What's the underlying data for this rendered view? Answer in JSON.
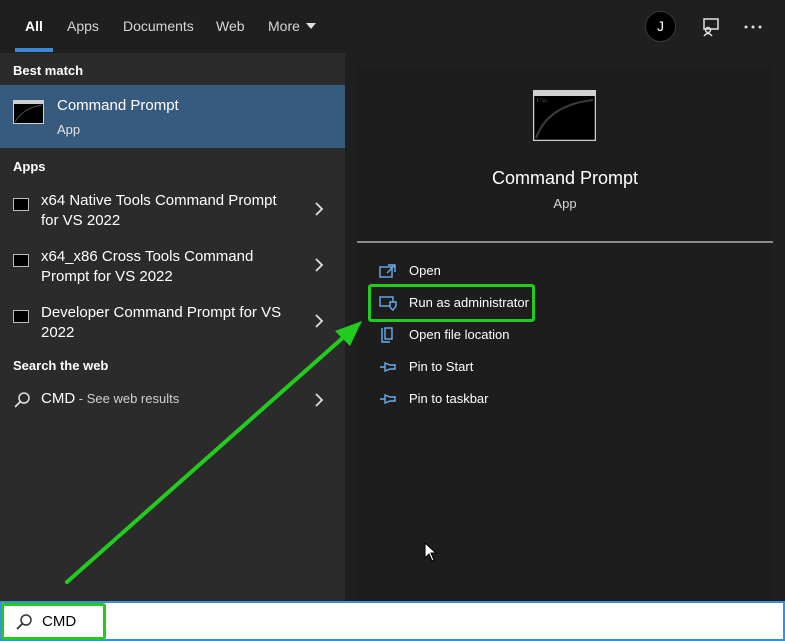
{
  "tabs": [
    {
      "label": "All"
    },
    {
      "label": "Apps"
    },
    {
      "label": "Documents"
    },
    {
      "label": "Web"
    },
    {
      "label": "More"
    }
  ],
  "avatar": {
    "initial": "J"
  },
  "left": {
    "best_match_heading": "Best match",
    "best_match": {
      "title": "Command Prompt",
      "subtitle": "App"
    },
    "apps_heading": "Apps",
    "apps": [
      {
        "label": "x64 Native Tools Command Prompt for VS 2022"
      },
      {
        "label": "x64_x86 Cross Tools Command Prompt for VS 2022"
      },
      {
        "label": "Developer Command Prompt for VS 2022"
      }
    ],
    "web_heading": "Search the web",
    "web": {
      "query": "CMD",
      "suffix": " - See web results"
    }
  },
  "right": {
    "title": "Command Prompt",
    "subtitle": "App",
    "actions": [
      {
        "label": "Open",
        "icon": "open-icon"
      },
      {
        "label": "Run as administrator",
        "icon": "run-as-admin-icon"
      },
      {
        "label": "Open file location",
        "icon": "file-location-icon"
      },
      {
        "label": "Pin to Start",
        "icon": "pin-icon"
      },
      {
        "label": "Pin to taskbar",
        "icon": "pin-icon"
      }
    ]
  },
  "search": {
    "value": "CMD"
  },
  "colors": {
    "accent": "#3c89d8",
    "highlight": "#21cc1f",
    "selected": "#375a7f"
  }
}
